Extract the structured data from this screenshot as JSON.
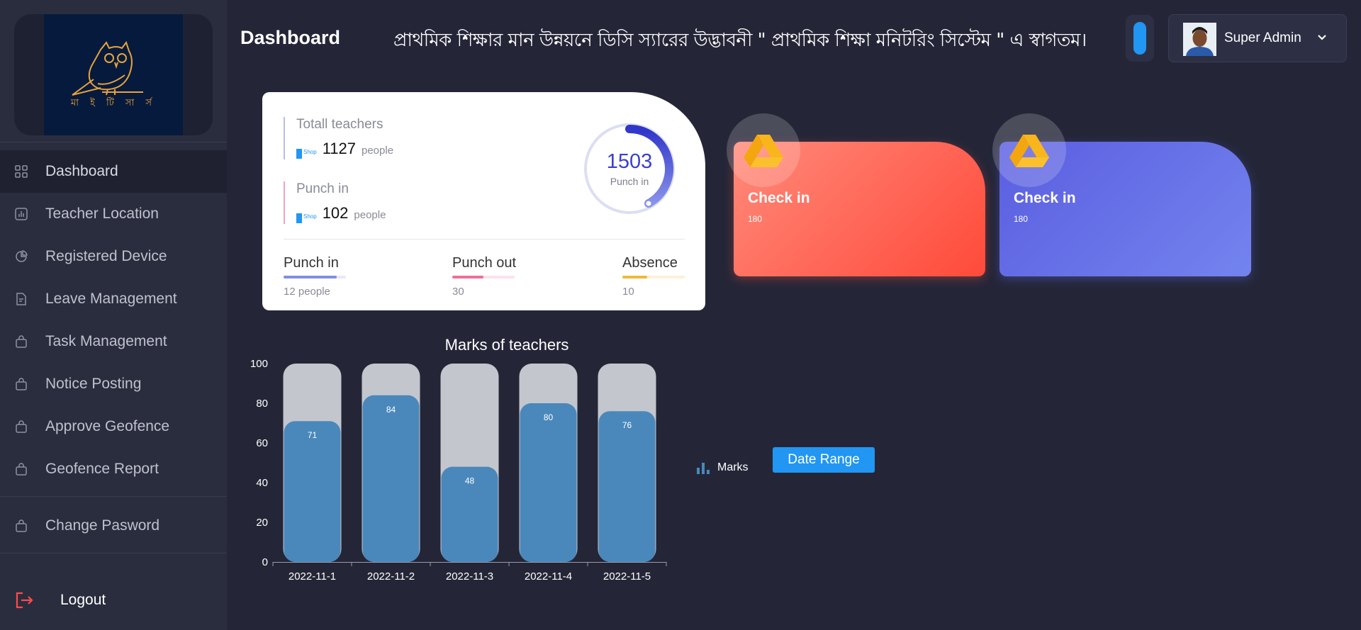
{
  "header": {
    "title": "Dashboard",
    "marquee": "প্রাথমিক শিক্ষার মান উন্নয়নে ডিসি স্যারের উদ্ভাবনী \" প্রাথমিক শিক্ষা মনিটরিং সিস্টেম \" এ স্বাগতম।",
    "user_name": "Super Admin"
  },
  "logo": {
    "text": "মা ই  টি সা র্স"
  },
  "sidebar": {
    "items": [
      {
        "label": "Dashboard"
      },
      {
        "label": "Teacher Location"
      },
      {
        "label": "Registered Device"
      },
      {
        "label": "Leave Management"
      },
      {
        "label": "Task Management"
      },
      {
        "label": "Notice Posting"
      },
      {
        "label": "Approve Geofence"
      },
      {
        "label": "Geofence Report"
      },
      {
        "label": "Change Pasword"
      }
    ],
    "logout": "Logout"
  },
  "stats": {
    "total_label": "Totall teachers",
    "total_value": "1127",
    "total_unit": "people",
    "punchin_label": "Punch in",
    "punchin_value": "102",
    "punchin_unit": "people",
    "shop_badge": "Shop",
    "ring_value": "1503",
    "ring_label": "Punch in",
    "ring_progress": 0.42,
    "mini": [
      {
        "label": "Punch in",
        "value": "12 people",
        "progress": 0.85,
        "color": "#7f8fe0"
      },
      {
        "label": "Punch out",
        "value": "30",
        "progress": 0.5,
        "color": "#ee6f96"
      },
      {
        "label": "Absence",
        "value": "10",
        "progress": 0.4,
        "color": "#f0b83c"
      }
    ]
  },
  "check_cards": [
    {
      "title": "Check in",
      "value": "180",
      "color": "#ff5a47"
    },
    {
      "title": "Check in",
      "value": "180",
      "color": "#6672e8"
    }
  ],
  "chart_data": {
    "type": "bar",
    "title": "Marks of teachers",
    "categories": [
      "2022-11-1",
      "2022-11-2",
      "2022-11-3",
      "2022-11-4",
      "2022-11-5"
    ],
    "series": [
      {
        "name": "Marks",
        "values": [
          71,
          84,
          48,
          80,
          76
        ]
      }
    ],
    "ylim": [
      0,
      100
    ],
    "yticks": [
      0,
      20,
      40,
      60,
      80,
      100
    ],
    "bar_color": "#4a88bb",
    "track_color": "#c4c6cd",
    "legend_position": "right"
  },
  "controls": {
    "date_range_label": "Date Range"
  }
}
